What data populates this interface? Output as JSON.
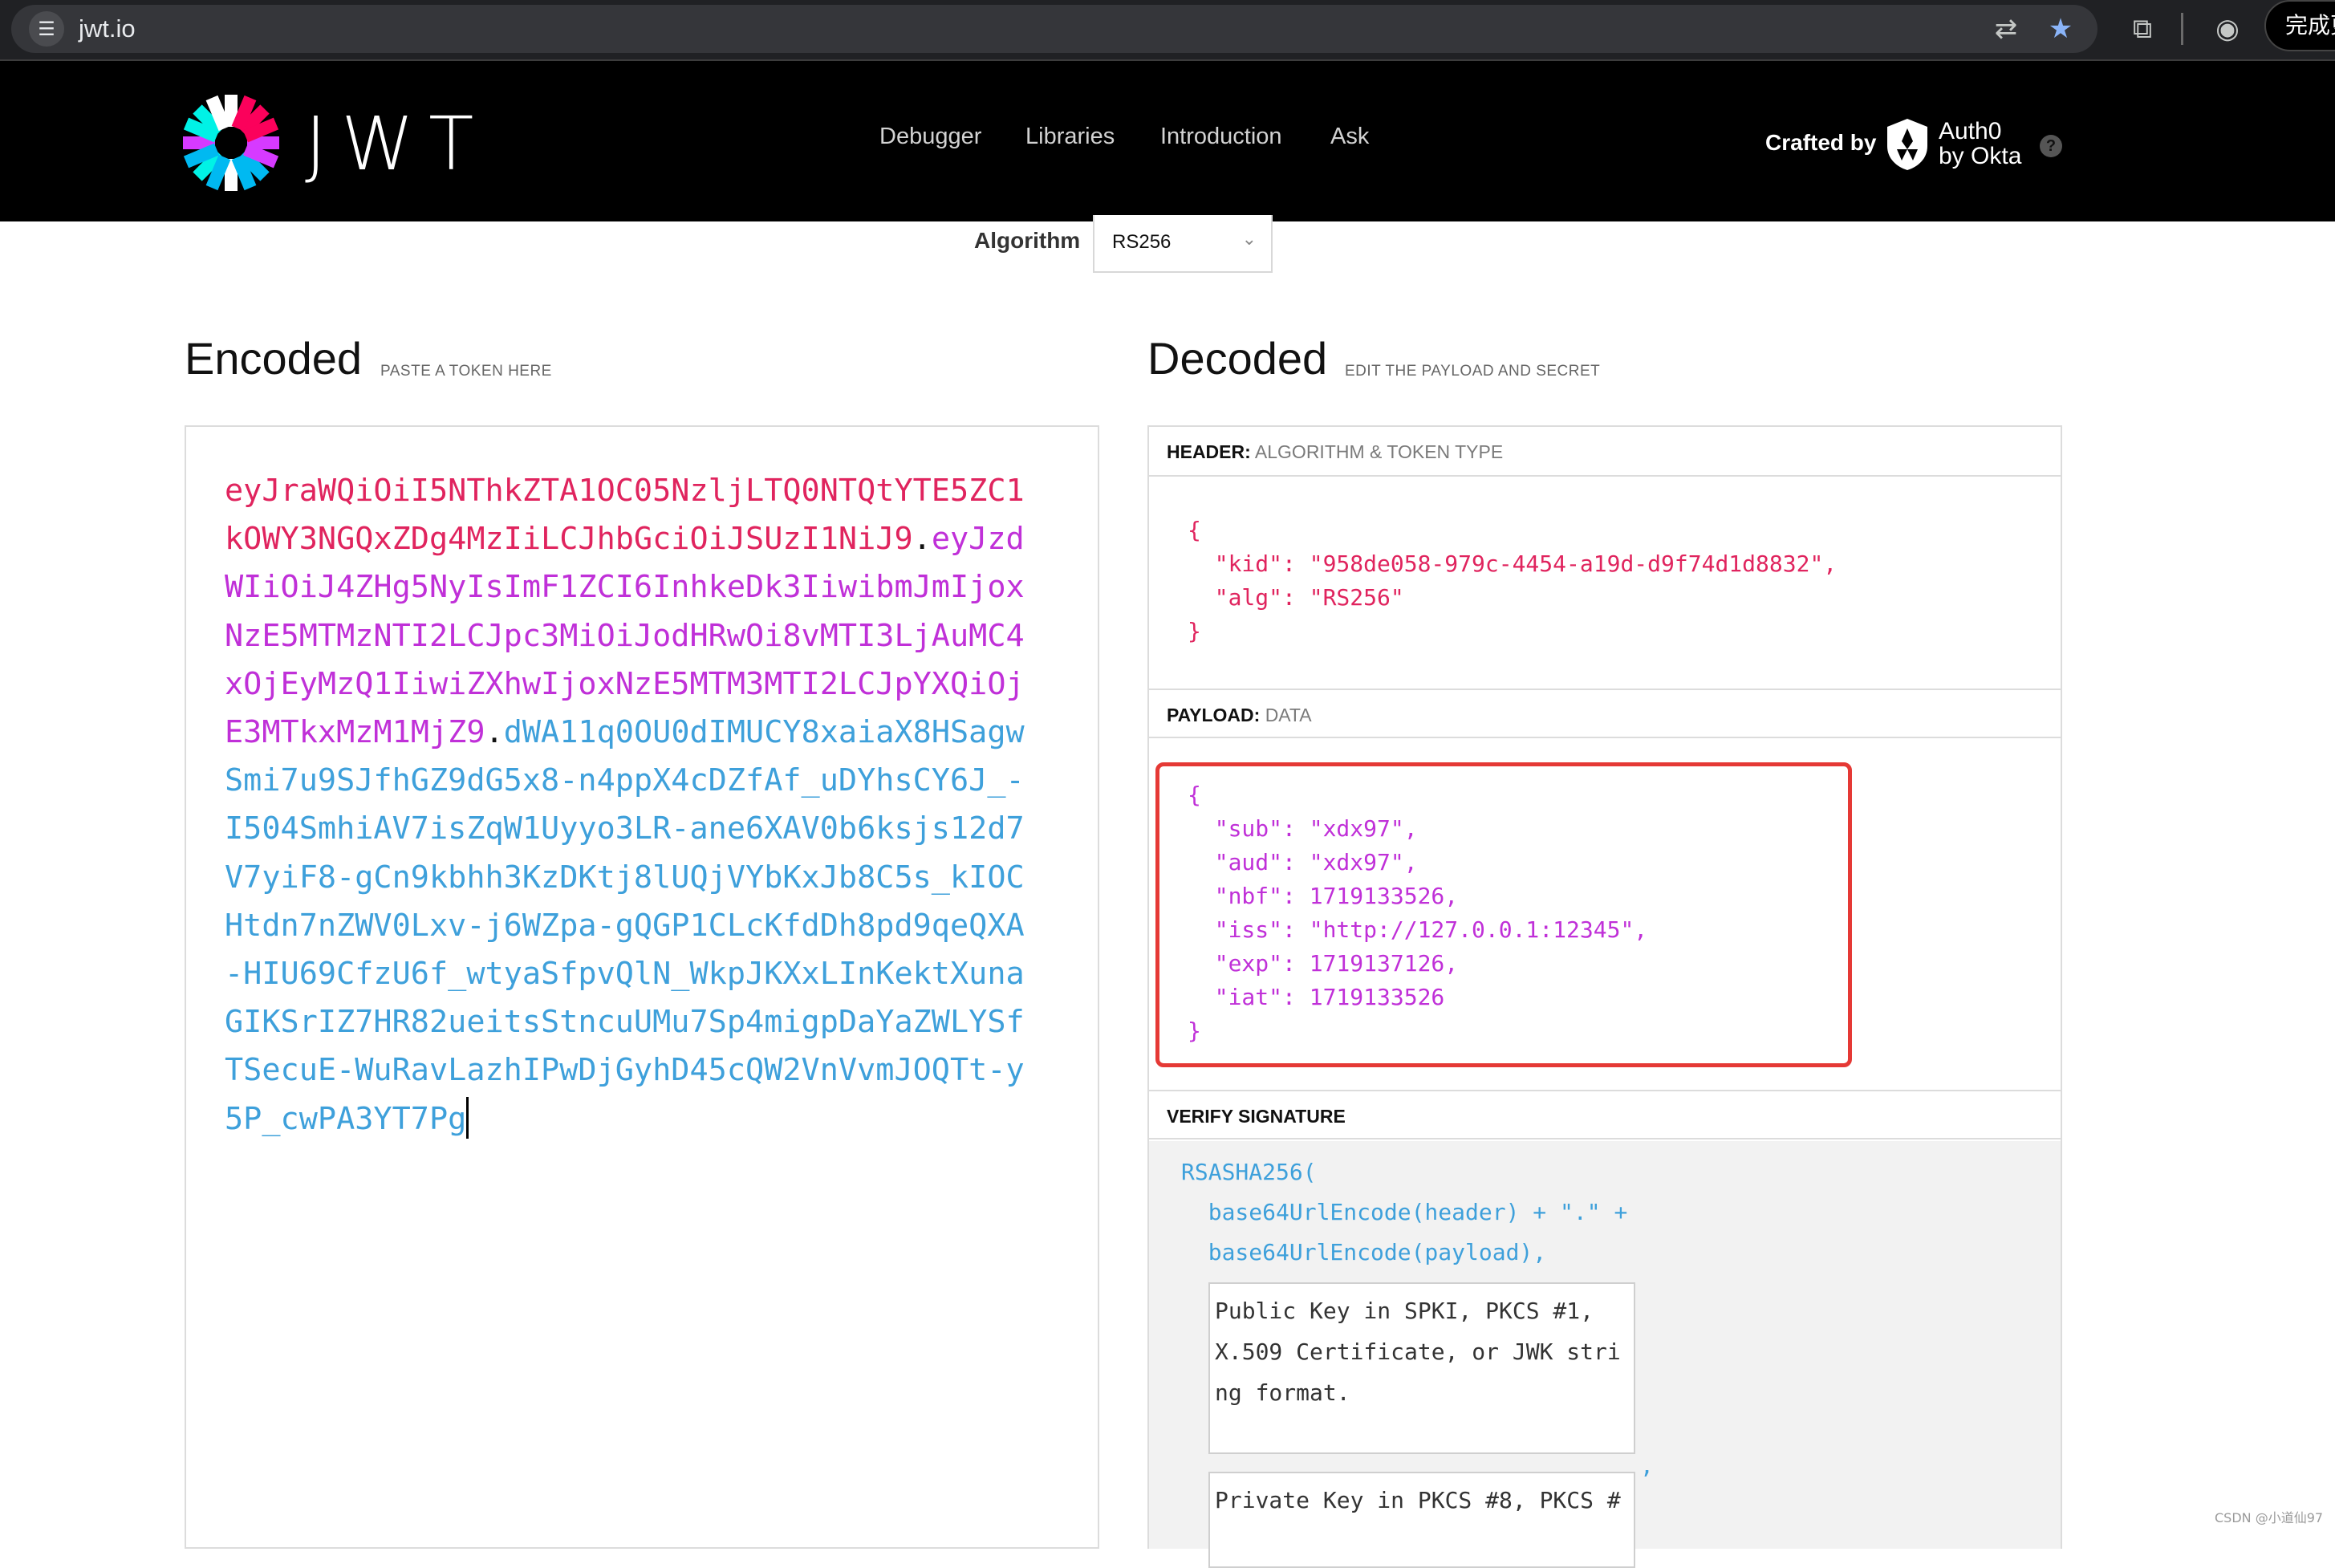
{
  "browser": {
    "url": "jwt.io",
    "update_button": "完成更",
    "icons": [
      "site-settings-icon",
      "translate-icon",
      "star-icon",
      "extensions-icon",
      "profile-icon"
    ]
  },
  "nav": {
    "logo_text": "JWT",
    "links": [
      "Debugger",
      "Libraries",
      "Introduction",
      "Ask"
    ],
    "crafted_by": "Crafted by",
    "partner_line1": "Auth0",
    "partner_line2": "by Okta",
    "help": "?"
  },
  "algorithm": {
    "label": "Algorithm",
    "value": "RS256"
  },
  "encoded": {
    "title": "Encoded",
    "subtitle": "PASTE A TOKEN HERE",
    "token_header": "eyJraWQiOiI5NThkZTA1OC05NzljLTQ0NTQtYTE5ZC1kOWY3NGQxZDg4MzIiLCJhbGciOiJSUzI1NiJ9",
    "token_payload": "eyJzdWIiOiJ4ZHg5NyIsImF1ZCI6InhkeDk3IiwibmJmIjoxNzE5MTMzNTI2LCJpc3MiOiJodHRwOi8vMTI3LjAuMC4xOjEyMzQ1IiwiZXhwIjoxNzE5MTM3MTI2LCJpYXQiOjE3MTkxMzM1MjZ9",
    "token_signature": "dWA11q0OU0dIMUCY8xaiaX8HSagwSmi7u9SJfhGZ9dG5x8-n4ppX4cDZfAf_uDYhsCY6J_-I504SmhiAV7isZqW1Uyyo3LR-ane6XAV0b6ksjs12d7V7yiF8-gCn9kbhh3KzDKtj8lUQjVYbKxJb8C5s_kIOCHtdn7nZWV0Lxv-j6WZpa-gQGP1CLcKfdDh8pd9qeQXA-HIU69CfzU6f_wtyaSfpvQlN_WkpJKXxLInKektXunaGIKSrIZ7HR82ueitsStncuUMu7Sp4migpDaYaZWLYSfTSecuE-WuRavLazhIPwDjGyhD45cQW2VnVvmJOQTt-y5P_cwPA3YT7Pg"
  },
  "decoded": {
    "title": "Decoded",
    "subtitle": "EDIT THE PAYLOAD AND SECRET",
    "header_label": "HEADER:",
    "header_sub": "ALGORITHM & TOKEN TYPE",
    "header_json": "{\n  \"kid\": \"958de058-979c-4454-a19d-d9f74d1d8832\",\n  \"alg\": \"RS256\"\n}",
    "payload_label": "PAYLOAD:",
    "payload_sub": "DATA",
    "payload_json": "{\n  \"sub\": \"xdx97\",\n  \"aud\": \"xdx97\",\n  \"nbf\": 1719133526,\n  \"iss\": \"http://127.0.0.1:12345\",\n  \"exp\": 1719137126,\n  \"iat\": 1719133526\n}",
    "verify_label": "VERIFY SIGNATURE",
    "sig_code": "RSASHA256(\n  base64UrlEncode(header) + \".\" +\n  base64UrlEncode(payload),",
    "public_key_placeholder": "Public Key in SPKI, PKCS #1, X.509 Certificate, or JWK string format.",
    "private_key_placeholder": "Private Key in PKCS #8, PKCS #"
  },
  "colors": {
    "header_token": "#e0245e",
    "payload_token": "#c030d8",
    "signature_token": "#3ea0db",
    "highlight": "#e53935"
  },
  "watermark": "CSDN @小道仙97"
}
